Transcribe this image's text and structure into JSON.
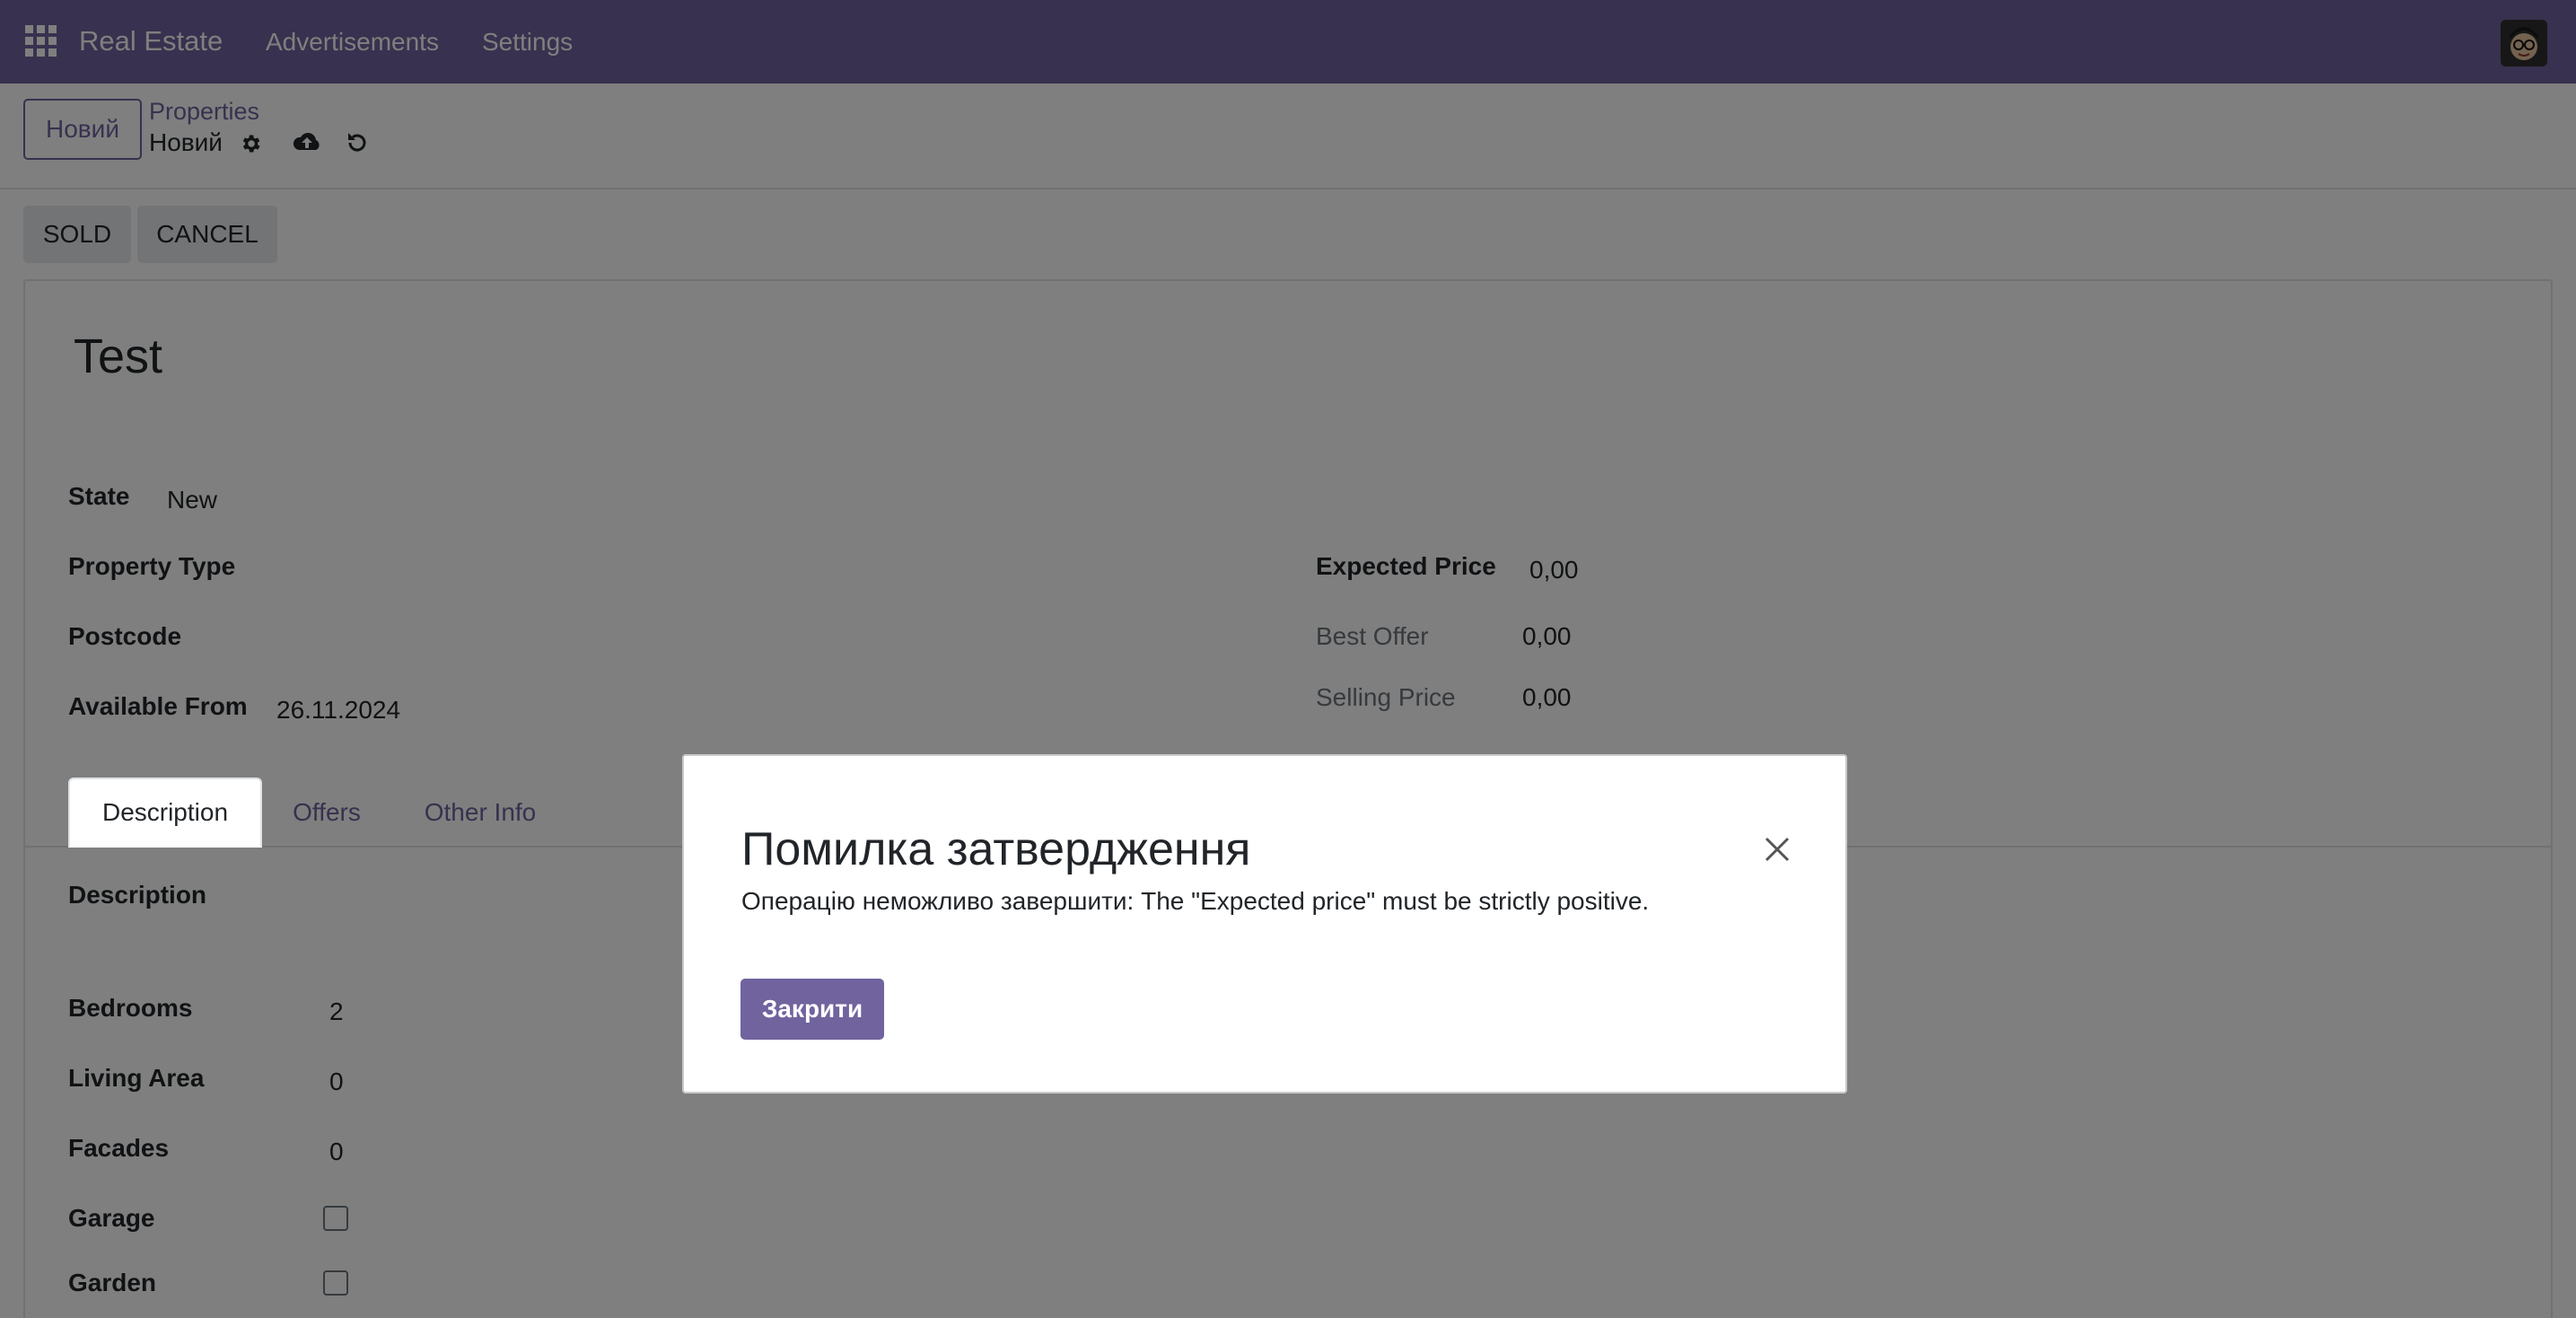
{
  "navbar": {
    "app_name": "Real Estate",
    "menu": [
      "Advertisements",
      "Settings"
    ]
  },
  "control_panel": {
    "new_button": "Новий",
    "breadcrumb_parent": "Properties",
    "breadcrumb_current": "Новий"
  },
  "statusbar": {
    "buttons": [
      "SOLD",
      "CANCEL"
    ]
  },
  "form": {
    "title": "Test",
    "fields": {
      "state_label": "State",
      "state_value": "New",
      "property_type_label": "Property Type",
      "postcode_label": "Postcode",
      "available_from_label": "Available From",
      "available_from_value": "26.11.2024",
      "expected_price_label": "Expected Price",
      "expected_price_value": "0,00",
      "best_offer_label": "Best Offer",
      "best_offer_value": "0,00",
      "selling_price_label": "Selling Price",
      "selling_price_value": "0,00"
    },
    "tabs": [
      "Description",
      "Offers",
      "Other Info"
    ],
    "description": {
      "description_label": "Description",
      "bedrooms_label": "Bedrooms",
      "bedrooms_value": "2",
      "living_area_label": "Living Area",
      "living_area_value": "0",
      "facades_label": "Facades",
      "facades_value": "0",
      "garage_label": "Garage",
      "garage_checked": false,
      "garden_label": "Garden",
      "garden_checked": false
    }
  },
  "dialog": {
    "title": "Помилка затвердження",
    "message": "Операцію неможливо завершити: The \"Expected price\" must be strictly positive.",
    "close_button": "Закрити"
  },
  "colors": {
    "brand": "#71639e",
    "backdrop": "rgba(0,0,0,0.5)"
  },
  "icons": {
    "apps": "apps-grid-icon",
    "gear": "gear-icon",
    "save": "cloud-upload-icon",
    "discard": "undo-icon",
    "close": "close-icon",
    "avatar": "user-avatar"
  }
}
